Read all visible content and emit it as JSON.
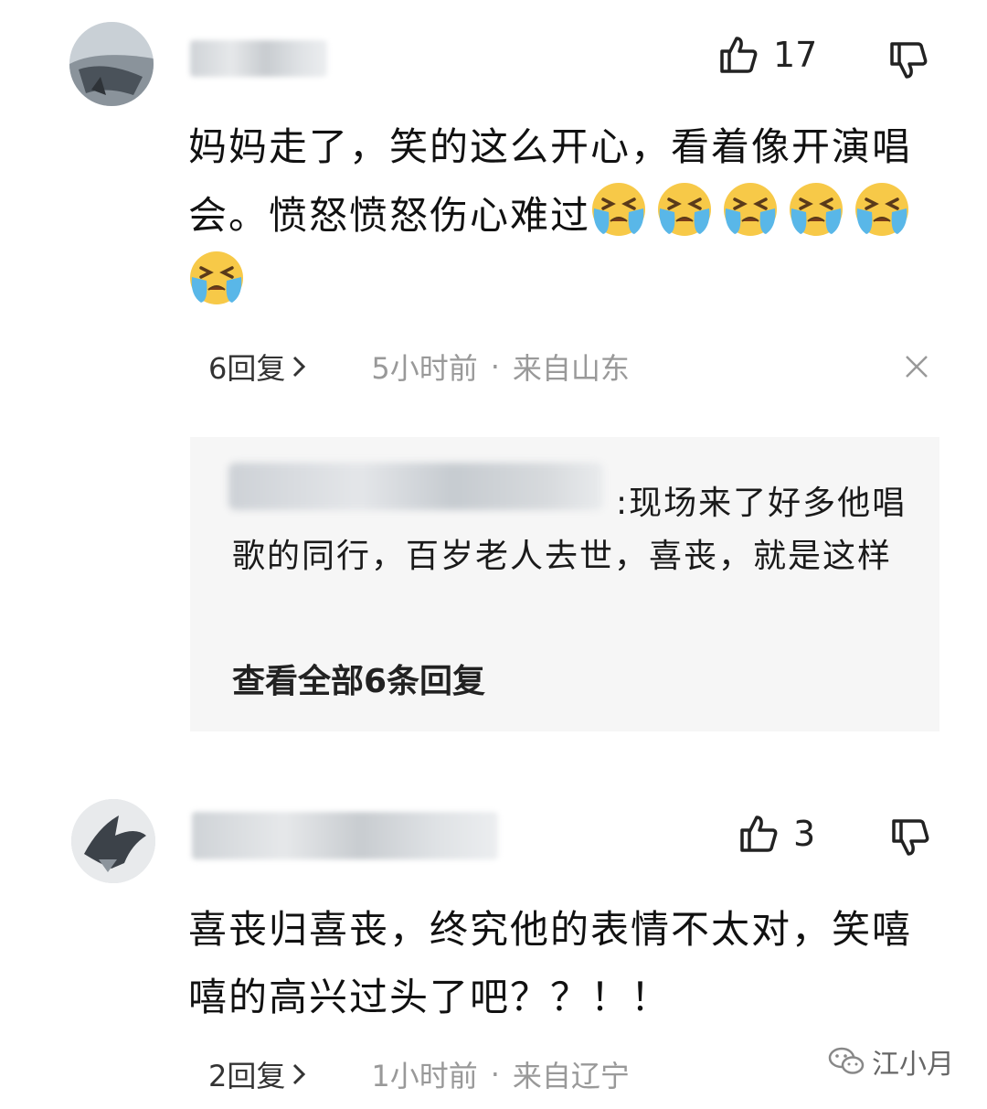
{
  "comments": [
    {
      "likes": "17",
      "text": "妈妈走了，笑的这么开心，看着像开演唱会。愤怒愤怒伤心难过",
      "emoji_count": 6,
      "emoji_icon": "loudly-crying-face-icon",
      "reply_count_label": "6回复",
      "time": "5小时前",
      "separator": "·",
      "location": "来自山东",
      "reply": {
        "text": "现场来了好多他唱歌的同行，百岁老人去世，喜丧，就是这样",
        "prefix": ":",
        "view_all": "查看全部6条回复"
      }
    },
    {
      "likes": "3",
      "text": "喜丧归喜丧，终究他的表情不太对，笑嘻嘻的高兴过头了吧？？！！",
      "reply_count_label": "2回复",
      "time": "1小时前",
      "separator": "·",
      "location": "来自辽宁"
    }
  ],
  "watermark": {
    "text": "江小月",
    "icon": "wechat-icon"
  },
  "colors": {
    "emoji_face": "#f7c948",
    "emoji_tears": "#59b7e8",
    "meta_text": "#999999"
  }
}
